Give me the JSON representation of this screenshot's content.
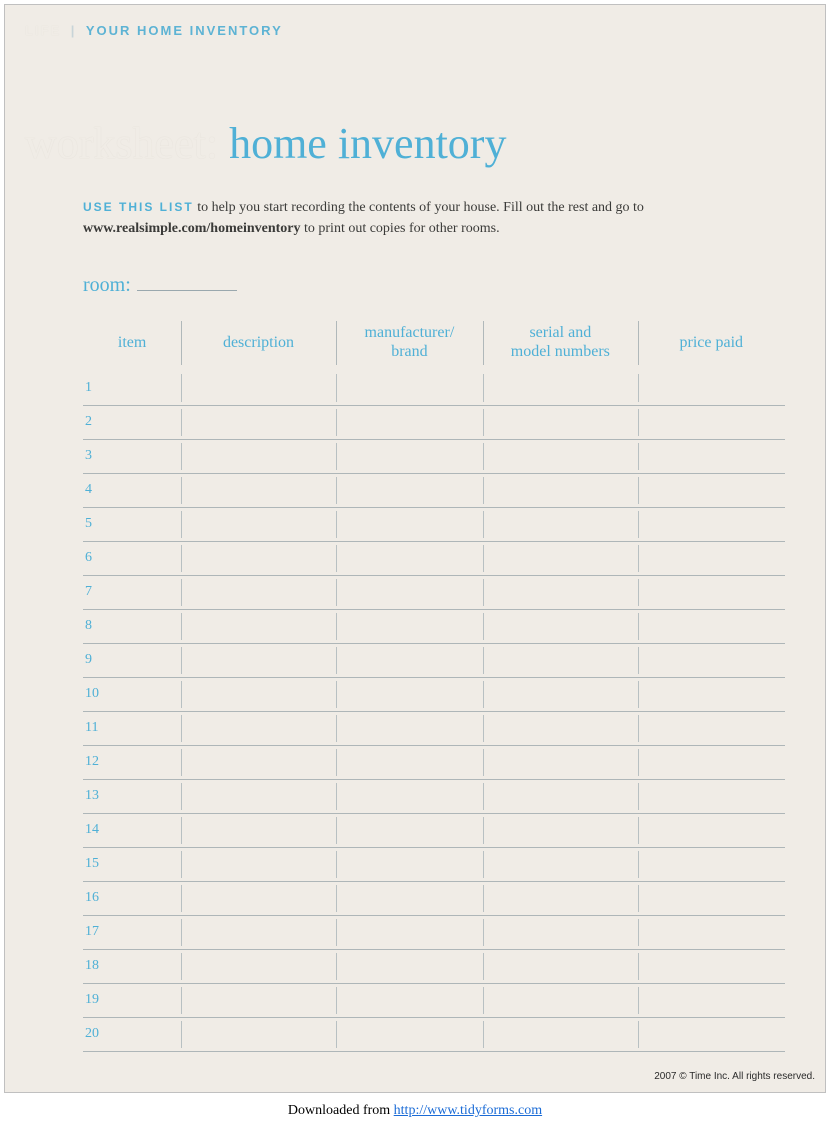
{
  "header": {
    "life_label": "life",
    "section_label": "YOUR HOME INVENTORY"
  },
  "title": {
    "prefix": "worksheet:",
    "main": "home inventory"
  },
  "intro": {
    "use_label": "USE THIS LIST",
    "text1": " to help you start recording the contents of your house. Fill out the rest and go to ",
    "url": "www.realsimple.com/homeinventory",
    "text2": " to print out copies for other rooms."
  },
  "room": {
    "label": "room:"
  },
  "table": {
    "headers": {
      "item": "item",
      "description": "description",
      "brand": "manufacturer/\nbrand",
      "serial": "serial and\nmodel numbers",
      "price": "price paid"
    },
    "rows": [
      {
        "num": "1"
      },
      {
        "num": "2"
      },
      {
        "num": "3"
      },
      {
        "num": "4"
      },
      {
        "num": "5"
      },
      {
        "num": "6"
      },
      {
        "num": "7"
      },
      {
        "num": "8"
      },
      {
        "num": "9"
      },
      {
        "num": "10"
      },
      {
        "num": "11"
      },
      {
        "num": "12"
      },
      {
        "num": "13"
      },
      {
        "num": "14"
      },
      {
        "num": "15"
      },
      {
        "num": "16"
      },
      {
        "num": "17"
      },
      {
        "num": "18"
      },
      {
        "num": "19"
      },
      {
        "num": "20"
      }
    ]
  },
  "copyright": "2007 © Time Inc. All rights reserved.",
  "footer": {
    "prefix": "Downloaded from ",
    "link": "http://www.tidyforms.com"
  }
}
